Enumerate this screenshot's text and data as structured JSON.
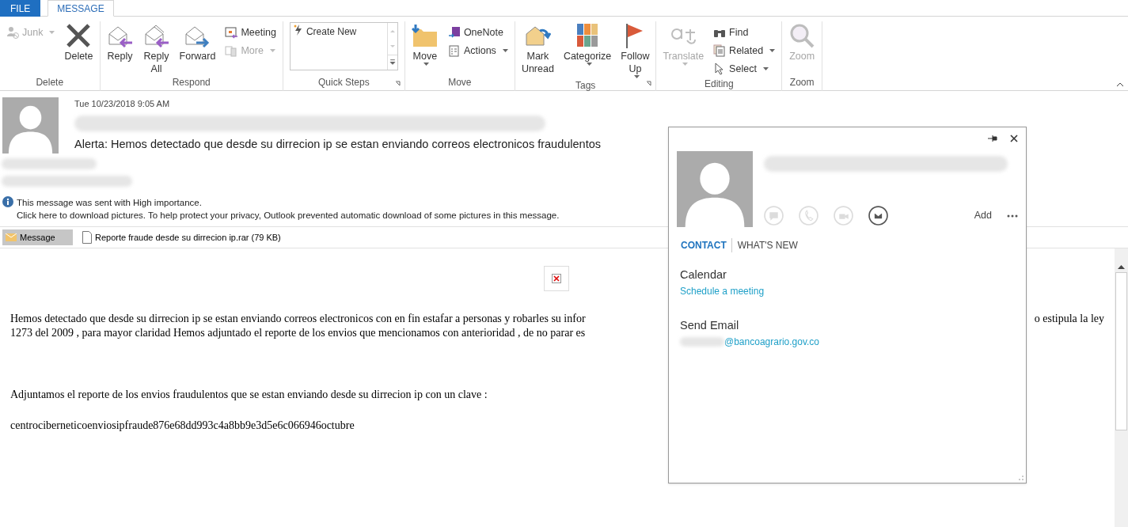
{
  "ribbon": {
    "tabs": [
      {
        "label": "FILE",
        "kind": "file",
        "selected": false
      },
      {
        "label": "MESSAGE",
        "kind": "tab",
        "selected": true
      }
    ],
    "groups": [
      {
        "label": "Delete",
        "items": [
          {
            "label": "Junk",
            "kind": "small",
            "disabled": true,
            "dropdown": true
          },
          {
            "label": "Delete",
            "kind": "large",
            "disabled": false
          }
        ]
      },
      {
        "label": "Respond",
        "items": [
          {
            "label": "Reply",
            "kind": "large",
            "disabled": false
          },
          {
            "label": "Reply All",
            "kind": "large",
            "disabled": false
          },
          {
            "label": "Forward",
            "kind": "large",
            "disabled": false
          },
          {
            "label": "Meeting",
            "kind": "small",
            "disabled": false
          },
          {
            "label": "More",
            "kind": "small",
            "disabled": true,
            "dropdown": true
          }
        ]
      },
      {
        "label": "Quick Steps",
        "launcher": true,
        "items": [
          {
            "label": "Create New",
            "kind": "gallery"
          }
        ]
      },
      {
        "label": "Move",
        "items": [
          {
            "label": "Move",
            "kind": "large",
            "disabled": false,
            "dropdown": true
          },
          {
            "label": "OneNote",
            "kind": "small",
            "disabled": false
          },
          {
            "label": "Actions",
            "kind": "small",
            "disabled": false,
            "dropdown": true
          }
        ]
      },
      {
        "label": "Tags",
        "launcher": true,
        "items": [
          {
            "label": "Mark Unread",
            "kind": "large",
            "disabled": false
          },
          {
            "label": "Categorize",
            "kind": "large",
            "disabled": false,
            "dropdown": true
          },
          {
            "label": "Follow Up",
            "kind": "large",
            "disabled": false,
            "dropdown": true
          }
        ]
      },
      {
        "label": "Editing",
        "items": [
          {
            "label": "Translate",
            "kind": "large",
            "disabled": true,
            "dropdown": true
          },
          {
            "label": "Find",
            "kind": "small",
            "disabled": false
          },
          {
            "label": "Related",
            "kind": "small",
            "disabled": false,
            "dropdown": true
          },
          {
            "label": "Select",
            "kind": "small",
            "disabled": false,
            "dropdown": true
          }
        ]
      },
      {
        "label": "Zoom",
        "items": [
          {
            "label": "Zoom",
            "kind": "large",
            "disabled": true
          }
        ]
      }
    ]
  },
  "message": {
    "date": "Tue 10/23/2018 9:05 AM",
    "subject": "Alerta:  Hemos detectado que desde su dirrecion ip se estan enviando correos electronicos fraudulentos",
    "notices": [
      "This message was sent with High importance.",
      "Click here to download pictures. To help protect your privacy, Outlook prevented automatic download of some pictures in this message."
    ],
    "attachments": [
      {
        "label": "Message",
        "kind": "message",
        "selected": true
      },
      {
        "label": "Reporte fraude desde su dirrecion ip.rar (79 KB)",
        "kind": "file",
        "selected": false
      }
    ]
  },
  "body": {
    "line_1_left": "Hemos detectado que desde su dirrecion ip se estan enviando correos electronicos con en fin estafar a personas y robarles su infor",
    "line_1_right": "o estipula la ley",
    "line_2": "1273 del 2009 ,  para mayor claridad Hemos adjuntado el reporte de los envios que mencionamos con anterioridad , de no parar es",
    "paragraphs": [
      "Adjuntamos el reporte de los envios fraudulentos que se estan enviando desde su dirrecion ip con un clave :",
      "centrociberneticoenviosipfraude876e68dd993c4a8bb9e3d5e6c066946octubre"
    ]
  },
  "contact_card": {
    "actions": [
      {
        "kind": "chat",
        "disabled": true
      },
      {
        "kind": "call",
        "disabled": true
      },
      {
        "kind": "video",
        "disabled": true
      },
      {
        "kind": "email",
        "disabled": false
      }
    ],
    "add": "Add",
    "tabs": [
      {
        "label": "CONTACT",
        "selected": true
      },
      {
        "label": "WHAT'S NEW",
        "selected": false
      }
    ],
    "sections": [
      {
        "title": "Calendar",
        "link": "Schedule a meeting"
      },
      {
        "title": "Send Email",
        "link": "@bancoagrario.gov.co"
      }
    ]
  }
}
